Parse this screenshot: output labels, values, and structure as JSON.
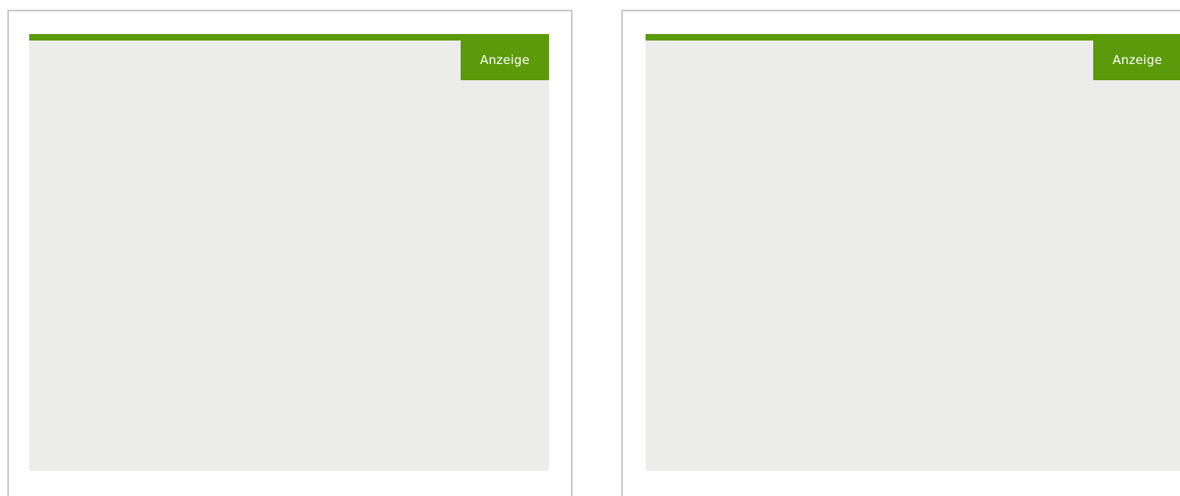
{
  "ads": [
    {
      "label": "Anzeige"
    },
    {
      "label": "Anzeige"
    }
  ],
  "colors": {
    "accent": "#5b9a0a",
    "slot_background": "#ececeb",
    "panel_border": "#c8c8c8",
    "label_text": "#ffffff"
  }
}
